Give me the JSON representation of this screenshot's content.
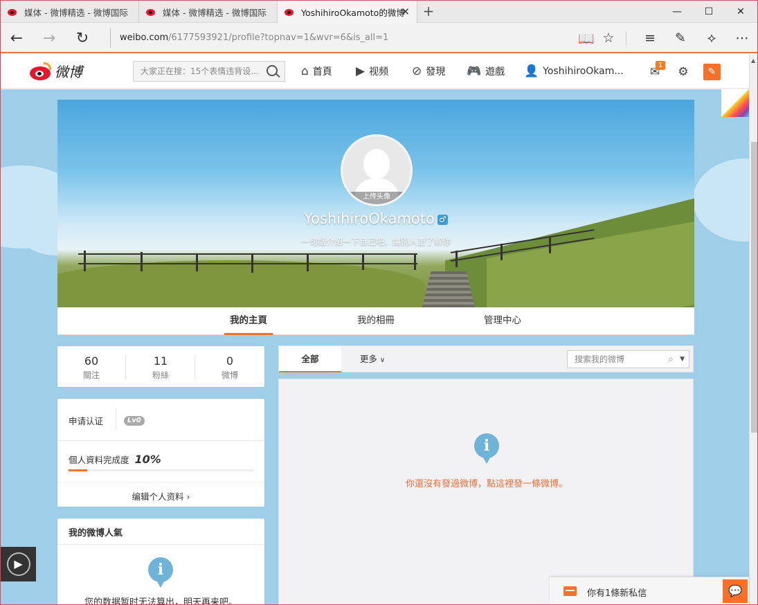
{
  "browser": {
    "tabs": [
      {
        "title": "媒体 - 微博精选 - 微博国际"
      },
      {
        "title": "媒体 - 微博精选 - 微博国际"
      },
      {
        "title": "YoshihiroOkamoto的微博"
      }
    ],
    "url_domain": "weibo.com",
    "url_path": "/6177593921/profile?topnav=1&wvr=6&is_all=1"
  },
  "header": {
    "logo_text": "微博",
    "search_placeholder": "大家正在搜：15个表情违背设...",
    "nav": [
      {
        "label": "首頁",
        "icon": "home-icon"
      },
      {
        "label": "视频",
        "icon": "video-icon"
      },
      {
        "label": "發現",
        "icon": "compass-icon"
      },
      {
        "label": "遊戲",
        "icon": "gamepad-icon"
      },
      {
        "label": "YoshihiroOkam...",
        "icon": "user-icon"
      }
    ],
    "message_badge": "1",
    "accent_color": "#f7712a"
  },
  "profile": {
    "upload_avatar": "上传头像",
    "name": "YoshihiroOkamoto",
    "gender_symbol": "♂",
    "intro": "一句話介紹一下自己吧，讓別人更了解你",
    "tabs": [
      "我的主頁",
      "我的相冊",
      "管理中心"
    ]
  },
  "stats": [
    {
      "num": "60",
      "label": "關注"
    },
    {
      "num": "11",
      "label": "粉絲"
    },
    {
      "num": "0",
      "label": "微博"
    }
  ],
  "verify": {
    "apply_label": "申请认证",
    "level": "Lv0",
    "completion_label": "個人資料完成度",
    "completion_value": "10%",
    "completion_fraction": 0.1,
    "edit_label": "编辑个人资料 ›"
  },
  "popularity": {
    "title": "我的微博人氣",
    "message": "您的数据暂时无法算出，明天再来吧。"
  },
  "feed": {
    "tabs": [
      "全部",
      "更多"
    ],
    "search_placeholder": "搜索我的微博",
    "empty_message": "你還沒有發過微博，點這裡發一條微博。"
  },
  "message_bar": {
    "text": "你有1條新私信"
  }
}
